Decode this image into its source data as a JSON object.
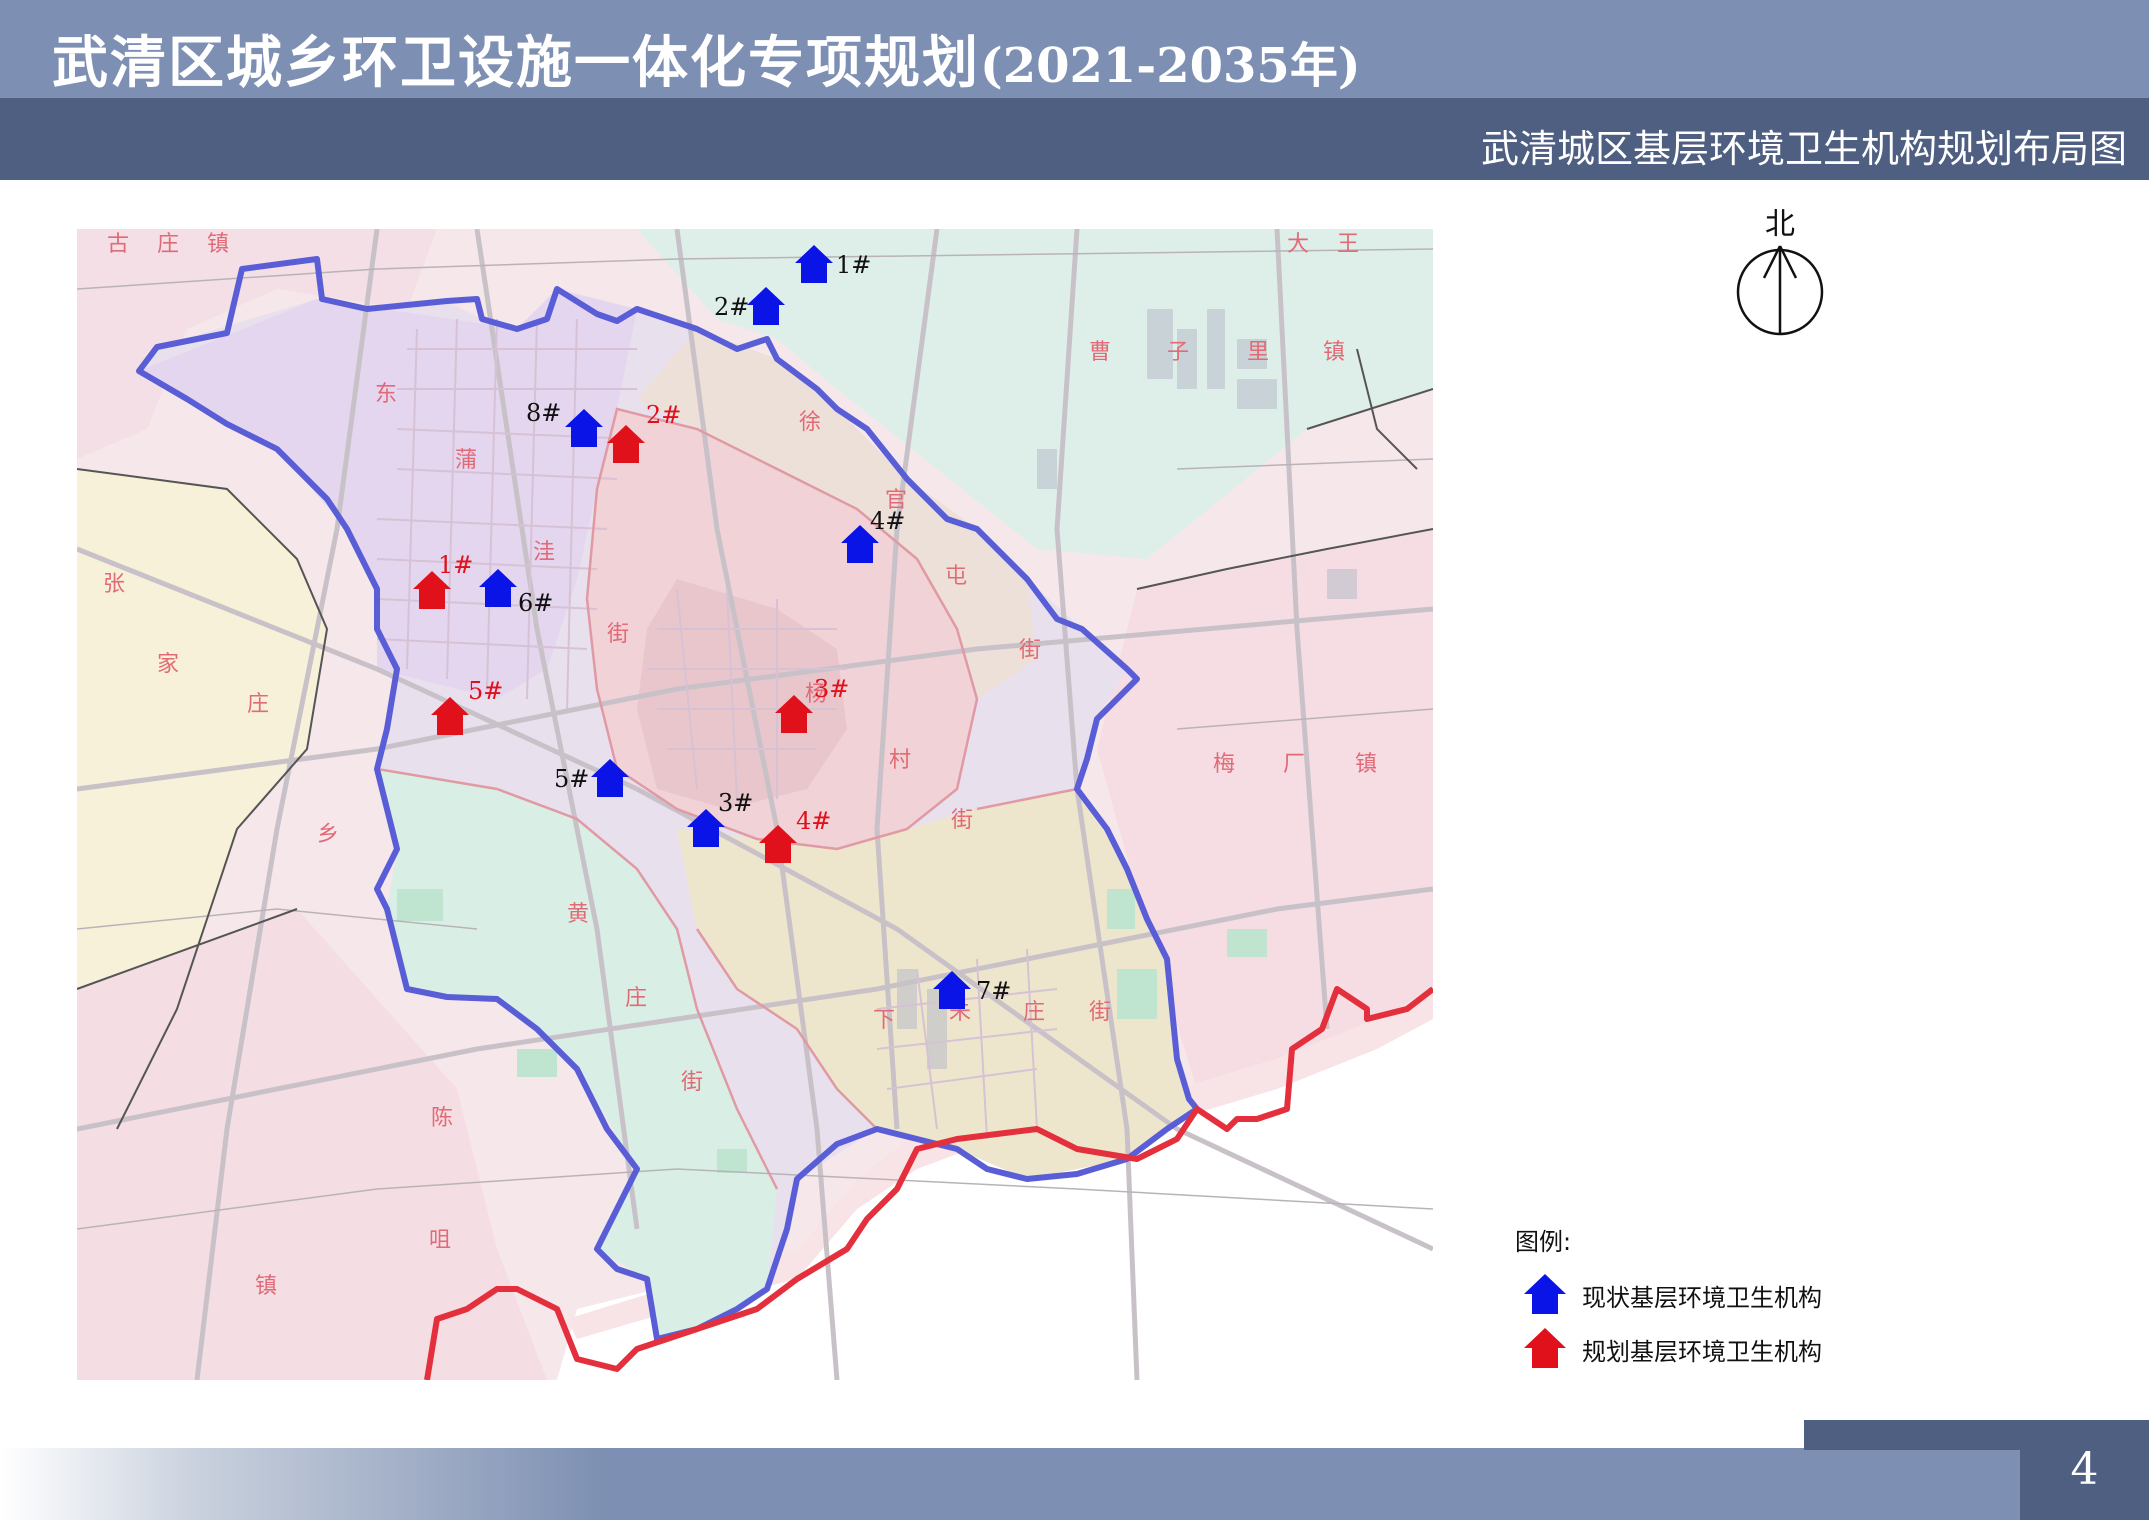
{
  "header": {
    "title": "武清区城乡环卫设施一体化专项规划",
    "title_years": "(2021-2035年)",
    "subtitle": "武清城区基层环境卫生机构规划布局图"
  },
  "north_label": "北",
  "map": {
    "district_labels": [
      "东",
      "蒲",
      "洼",
      "街",
      "徐",
      "官",
      "屯",
      "街",
      "杨",
      "村",
      "街",
      "黄",
      "庄",
      "街",
      "下",
      "朱",
      "庄",
      "街",
      "张",
      "家",
      "庄",
      "乡",
      "陈",
      "咀",
      "镇",
      "曹",
      "子",
      "里",
      "镇",
      "梅",
      "厂",
      "镇",
      "大",
      "王",
      "古",
      "庄",
      "镇"
    ],
    "existing": [
      {
        "label": "1#"
      },
      {
        "label": "2#"
      },
      {
        "label": "3#"
      },
      {
        "label": "4#"
      },
      {
        "label": "5#"
      },
      {
        "label": "6#"
      },
      {
        "label": "7#"
      },
      {
        "label": "8#"
      }
    ],
    "planned": [
      {
        "label": "1#"
      },
      {
        "label": "2#"
      },
      {
        "label": "3#"
      },
      {
        "label": "4#"
      },
      {
        "label": "5#"
      }
    ]
  },
  "legend": {
    "title": "图例:",
    "existing_label": "现状基层环境卫生机构",
    "planned_label": "规划基层环境卫生机构"
  },
  "colors": {
    "existing": "#0b14e6",
    "planned": "#e0111a",
    "boundary": "#5b5fd6",
    "header_light": "#7d8fb2",
    "header_dark": "#4e5f82"
  },
  "page_number": "4"
}
